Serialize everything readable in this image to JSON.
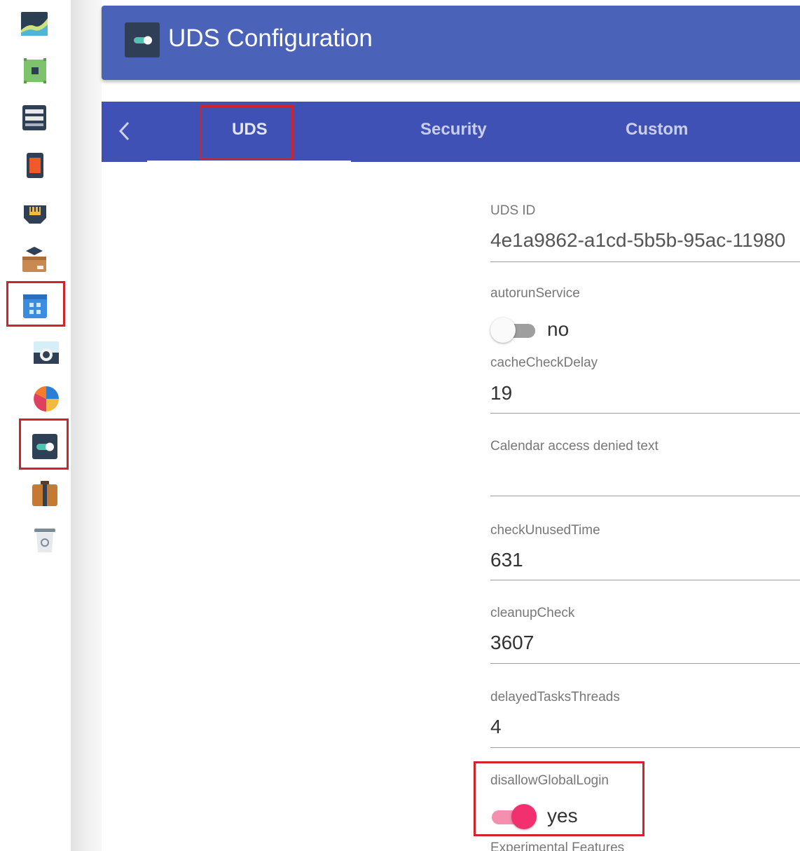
{
  "app": {
    "header_title": "UDS Configuration",
    "header_icon": "toggle-icon"
  },
  "sidebar": {
    "items": [
      {
        "name": "chart-icon"
      },
      {
        "name": "chip-icon"
      },
      {
        "name": "server-icon"
      },
      {
        "name": "device-icon"
      },
      {
        "name": "network-port-icon"
      },
      {
        "name": "package-icon"
      },
      {
        "name": "calendar-icon",
        "highlighted": true
      },
      {
        "name": "camera-icon"
      },
      {
        "name": "pie-chart-icon"
      },
      {
        "name": "toggle-icon",
        "highlighted": true,
        "active": true
      },
      {
        "name": "briefcase-icon"
      },
      {
        "name": "trash-icon"
      }
    ]
  },
  "tabs": {
    "back_icon": "chevron-left-icon",
    "items": [
      {
        "label": "UDS",
        "active": true
      },
      {
        "label": "Security",
        "active": false
      },
      {
        "label": "Custom",
        "active": false
      }
    ]
  },
  "form": {
    "uds_id": {
      "label": "UDS ID",
      "value": "4e1a9862-a1cd-5b5b-95ac-11980"
    },
    "autorun_service": {
      "label": "autorunService",
      "state": "no",
      "on": false
    },
    "cache_check_delay": {
      "label": "cacheCheckDelay",
      "value": "19"
    },
    "calendar_denied": {
      "label": "Calendar access denied text",
      "value": ""
    },
    "check_unused_time": {
      "label": "checkUnusedTime",
      "value": "631"
    },
    "cleanup_check": {
      "label": "cleanupCheck",
      "value": "3607"
    },
    "delayed_tasks_threads": {
      "label": "delayedTasksThreads",
      "value": "4"
    },
    "disallow_global_login": {
      "label": "disallowGlobalLogin",
      "state": "yes",
      "on": true
    },
    "experimental_features": {
      "label": "Experimental Features"
    }
  },
  "colors": {
    "header": "#4a63b8",
    "tabs": "#3f51b5",
    "highlight": "#d0232c",
    "toggle_on": "#f2306f",
    "toggle_on_track": "#f58fb0",
    "toggle_off_track": "#9e9e9e"
  }
}
